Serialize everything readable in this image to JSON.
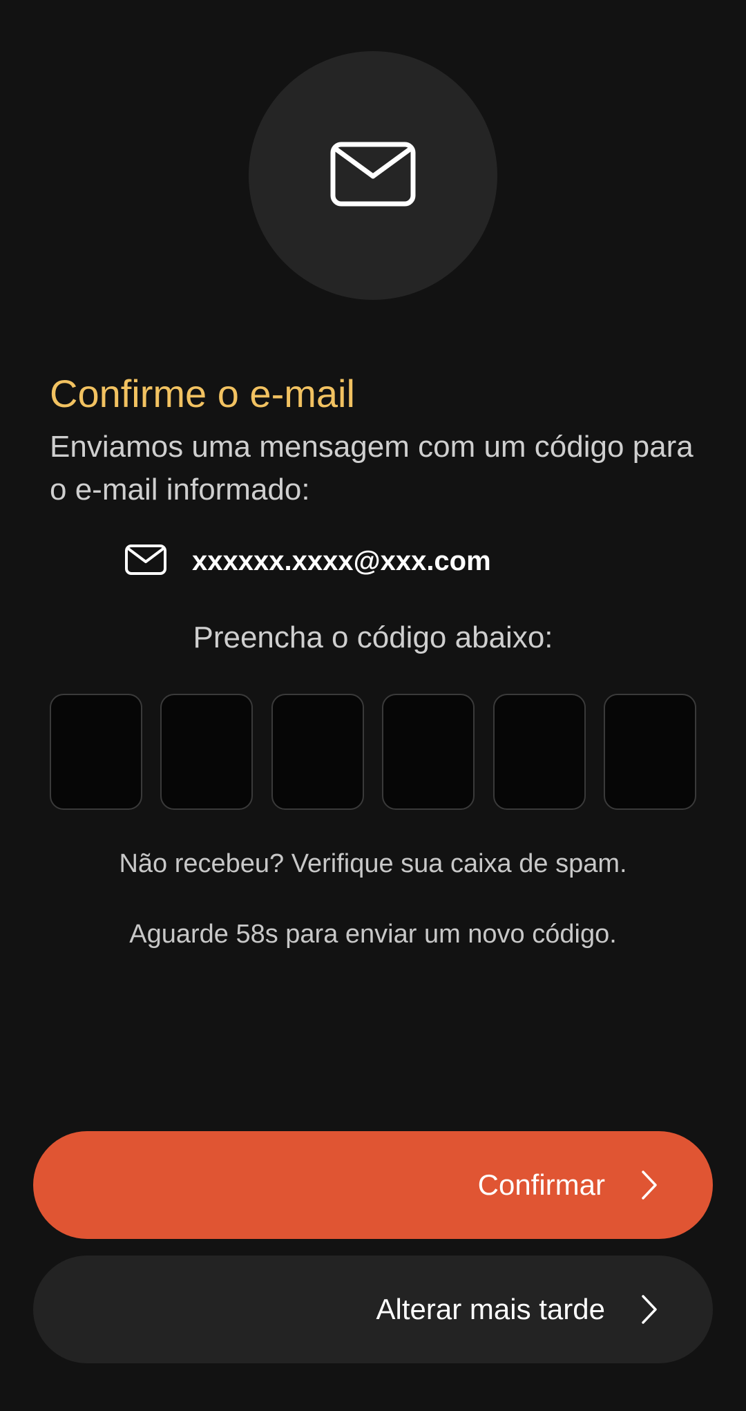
{
  "header": {
    "icon": "mail-icon"
  },
  "title": "Confirme o e-mail",
  "subtitle": "Enviamos uma mensagem com um código para o e-mail informado:",
  "email": {
    "icon": "mail-icon",
    "address": "xxxxxx.xxxx@xxx.com"
  },
  "code": {
    "label": "Preencha o código abaixo:",
    "digits": [
      "",
      "",
      "",
      "",
      "",
      ""
    ]
  },
  "hints": {
    "spam": "Não recebeu? Verifique sua caixa de spam.",
    "resend": "Aguarde 58s para enviar um novo código."
  },
  "actions": {
    "confirm_label": "Confirmar",
    "later_label": "Alterar mais tarde",
    "chevron_icon": "chevron-right-icon"
  },
  "colors": {
    "background": "#121212",
    "accent": "#E05533",
    "title": "#F2C261",
    "secondary_button": "#232323"
  }
}
